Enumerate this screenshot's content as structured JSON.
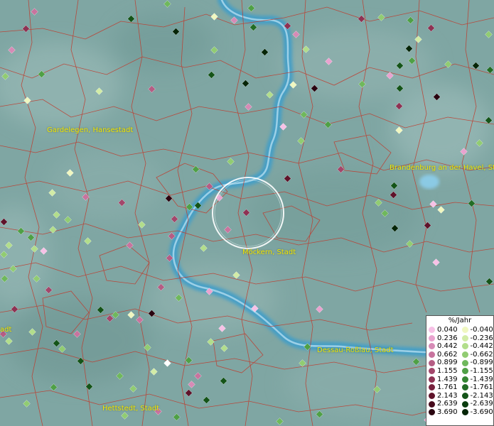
{
  "legend": {
    "title": "%/Jahr",
    "positive": [
      {
        "value": "0.040",
        "color": "#f7c1e6"
      },
      {
        "value": "0.236",
        "color": "#e9a3cf"
      },
      {
        "value": "0.442",
        "color": "#d68bb6"
      },
      {
        "value": "0.662",
        "color": "#c8749e"
      },
      {
        "value": "0.899",
        "color": "#b55d84"
      },
      {
        "value": "1.155",
        "color": "#a3476b"
      },
      {
        "value": "1.439",
        "color": "#8e3253"
      },
      {
        "value": "1.761",
        "color": "#77213d"
      },
      {
        "value": "2.143",
        "color": "#5f132a"
      },
      {
        "value": "2.639",
        "color": "#460a1b"
      },
      {
        "value": "3.690",
        "color": "#2a0410"
      }
    ],
    "negative": [
      {
        "value": "-0.040",
        "color": "#f0f7c0"
      },
      {
        "value": "-0.236",
        "color": "#d2eca6"
      },
      {
        "value": "-0.442",
        "color": "#b2de8b"
      },
      {
        "value": "-0.662",
        "color": "#91cc72"
      },
      {
        "value": "-0.899",
        "color": "#6fb85c"
      },
      {
        "value": "-1.155",
        "color": "#4fa046"
      },
      {
        "value": "-1.439",
        "color": "#358733"
      },
      {
        "value": "-1.761",
        "color": "#226d25"
      },
      {
        "value": "-2.143",
        "color": "#145418"
      },
      {
        "value": "-2.639",
        "color": "#0b3d0f"
      },
      {
        "value": "-3.690",
        "color": "#052507"
      }
    ]
  },
  "cities": [
    {
      "name": "Gardelegen, Hansestadt"
    },
    {
      "name": "Brandenburg an der Havel, St"
    },
    {
      "name": "Möckern, Stadt"
    },
    {
      "name": "Dessau-Roßlau, Stadt"
    },
    {
      "name": "Hettstedt, Stadt"
    },
    {
      "name": "adt"
    }
  ],
  "colors": {
    "background": "#7fa6a3",
    "boundary": "#c0392b",
    "river": "#3f9ec9",
    "label": "#f2e600",
    "selection_ring": "#ffffff"
  }
}
